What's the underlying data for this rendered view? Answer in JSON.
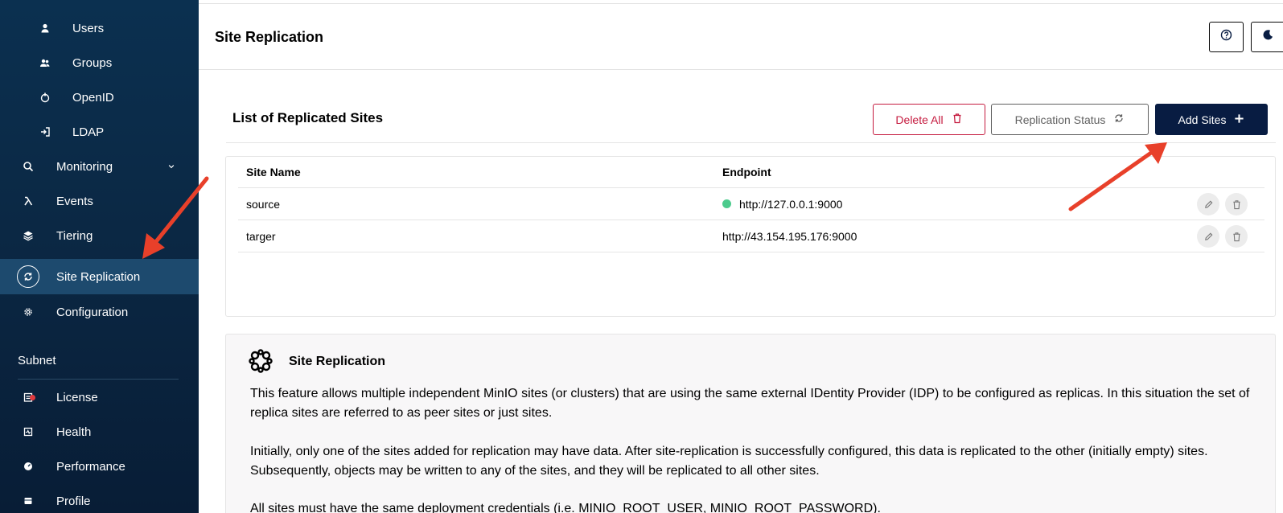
{
  "sidebar": {
    "sub_items": [
      {
        "label": "Users",
        "icon": "user-icon"
      },
      {
        "label": "Groups",
        "icon": "groups-icon"
      },
      {
        "label": "OpenID",
        "icon": "openid-icon"
      },
      {
        "label": "LDAP",
        "icon": "ldap-icon"
      }
    ],
    "items": [
      {
        "label": "Monitoring",
        "icon": "monitoring-icon"
      },
      {
        "label": "Events",
        "icon": "lambda-icon"
      },
      {
        "label": "Tiering",
        "icon": "tiering-icon"
      },
      {
        "label": "Site Replication",
        "icon": "site-replication-icon",
        "active": true
      },
      {
        "label": "Configuration",
        "icon": "gear-icon"
      }
    ],
    "subnet_title": "Subnet",
    "subnet_items": [
      {
        "label": "License",
        "icon": "license-icon"
      },
      {
        "label": "Health",
        "icon": "health-icon"
      },
      {
        "label": "Performance",
        "icon": "performance-icon"
      },
      {
        "label": "Profile",
        "icon": "profile-icon"
      }
    ]
  },
  "header": {
    "title": "Site Replication",
    "help_icon": "help-icon",
    "theme_icon": "moon-icon"
  },
  "list": {
    "title": "List of Replicated Sites",
    "delete_all_label": "Delete All",
    "replication_status_label": "Replication Status",
    "add_sites_label": "Add Sites",
    "columns": [
      "Site Name",
      "Endpoint"
    ],
    "rows": [
      {
        "site_name": "source",
        "endpoint": "http://127.0.0.1:9000",
        "online_indicator": true
      },
      {
        "site_name": "targer",
        "endpoint": "http://43.154.195.176:9000",
        "online_indicator": false
      }
    ]
  },
  "info": {
    "title": "Site Replication",
    "paragraphs": [
      "This feature allows multiple independent MinIO sites (or clusters) that are using the same external IDentity Provider (IDP) to be configured as replicas. In this situation the set of replica sites are referred to as peer sites or just sites.",
      "Initially, only one of the sites added for replication may have data. After site-replication is successfully configured, this data is replicated to the other (initially empty) sites. Subsequently, objects may be written to any of the sites, and they will be replicated to all other sites.",
      "All sites must have the same deployment credentials (i.e. MINIO_ROOT_USER, MINIO_ROOT_PASSWORD)."
    ]
  },
  "colors": {
    "sidebar_bg": "#0b2844",
    "active_bg": "#1d4a6e",
    "primary": "#081c42",
    "danger": "#c51b3f",
    "online": "#4ccb8d",
    "annotation_arrow": "#e8402a"
  }
}
